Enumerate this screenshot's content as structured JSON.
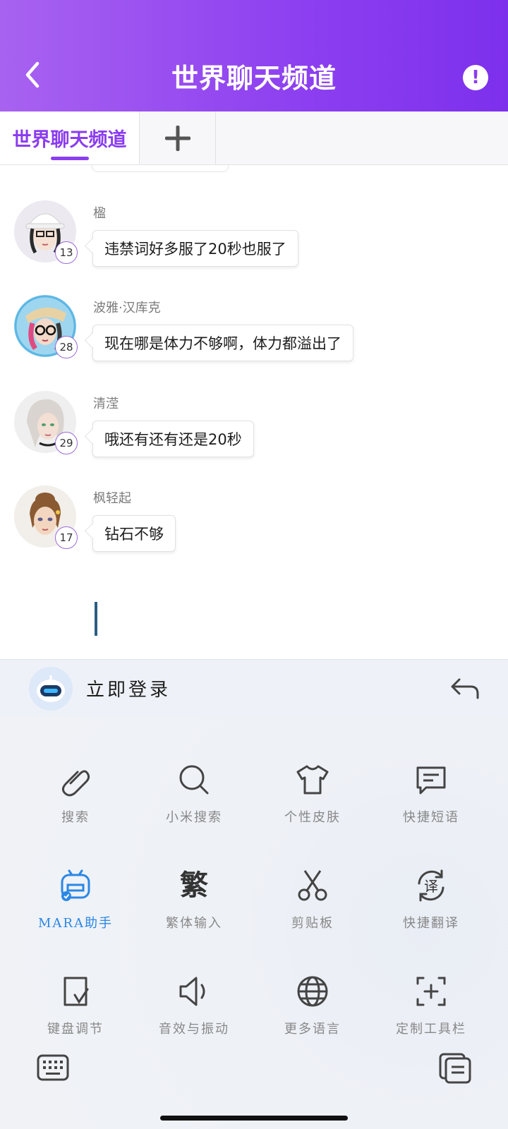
{
  "header": {
    "title": "世界聊天频道",
    "back_icon": "chevron-left-icon",
    "info_icon": "exclamation-icon"
  },
  "tabs": [
    {
      "label": "世界聊天频道",
      "active": true
    },
    {
      "label": "+",
      "icon": "plus-icon"
    }
  ],
  "messages": [
    {
      "name": "楹",
      "level": "13",
      "text": "违禁词好多服了20秒也服了",
      "hair": "#2a2a2a",
      "skin": "#f6e2d5",
      "bg": "#eceaf0"
    },
    {
      "name": "波雅·汉库克",
      "level": "28",
      "text": "现在哪是体力不够啊，体力都溢出了",
      "hair": "#e04a80",
      "skin": "#f3d9c8",
      "bg": "#9fd6ef"
    },
    {
      "name": "清滢",
      "level": "29",
      "text": "哦还有还有还是20秒",
      "hair": "#d9d4cf",
      "skin": "#f3dfd4",
      "bg": "#efefef"
    },
    {
      "name": "枫轻起",
      "level": "17",
      "text": "钻石不够",
      "hair": "#8a5a32",
      "skin": "#f2d6c0",
      "bg": "#f2efea"
    }
  ],
  "keyboard": {
    "login_text": "立即登录",
    "undo_icon": "undo-arrow-icon",
    "tools": [
      {
        "label": "搜索",
        "icon": "paperclip-icon"
      },
      {
        "label": "小米搜索",
        "icon": "search-icon"
      },
      {
        "label": "个性皮肤",
        "icon": "tshirt-icon"
      },
      {
        "label": "快捷短语",
        "icon": "chat-bubble-icon"
      },
      {
        "label": "MARA助手",
        "icon": "robot-assistant-icon",
        "active": true
      },
      {
        "label": "繁体输入",
        "icon": "traditional-char-icon",
        "glyph": "繁"
      },
      {
        "label": "剪贴板",
        "icon": "scissors-icon"
      },
      {
        "label": "快捷翻译",
        "icon": "translate-icon",
        "glyph": "译"
      },
      {
        "label": "键盘调节",
        "icon": "keyboard-adjust-icon"
      },
      {
        "label": "音效与振动",
        "icon": "speaker-icon"
      },
      {
        "label": "更多语言",
        "icon": "globe-icon"
      },
      {
        "label": "定制工具栏",
        "icon": "add-frame-icon"
      }
    ],
    "bottom_left_icon": "keyboard-icon",
    "bottom_right_icon": "clipboard-pages-icon"
  },
  "colors": {
    "accent": "#8a3cf0",
    "active_tool": "#2b87e6"
  }
}
